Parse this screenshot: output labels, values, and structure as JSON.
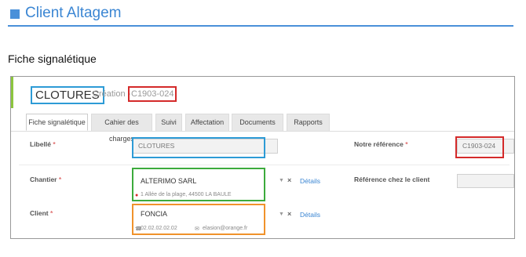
{
  "doc": {
    "title": "Client Altagem",
    "section": "Fiche signalétique"
  },
  "record": {
    "name": "CLOTURES",
    "creation_label": "Création -",
    "reference": "C1903-024"
  },
  "tabs": [
    {
      "label": "Fiche signalétique"
    },
    {
      "label": "Cahier des charges"
    },
    {
      "label": "Suivi"
    },
    {
      "label": "Affectation"
    },
    {
      "label": "Documents"
    },
    {
      "label": "Rapports"
    }
  ],
  "form": {
    "libelle": {
      "label": "Libellé",
      "value": "CLOTURES"
    },
    "notre_reference": {
      "label": "Notre référence",
      "value": "C1903-024"
    },
    "chantier": {
      "label": "Chantier",
      "value": "ALTERIMO SARL",
      "address": "1 Allée de la plage, 44500 LA BAULE",
      "clear": "×",
      "details": "Détails"
    },
    "reference_client": {
      "label": "Référence chez le client",
      "value": ""
    },
    "client": {
      "label": "Client",
      "value": "FONCIA",
      "phone": "02.02.02.02.02",
      "email": "elasion@orange.fr",
      "clear": "×",
      "details": "Détails"
    },
    "required_mark": "*"
  },
  "colors": {
    "accent": "#3b86d3",
    "highlight_blue": "#2d9bd6",
    "highlight_red": "#d42a2a",
    "highlight_green": "#3cab3c",
    "highlight_orange": "#f0922b"
  }
}
